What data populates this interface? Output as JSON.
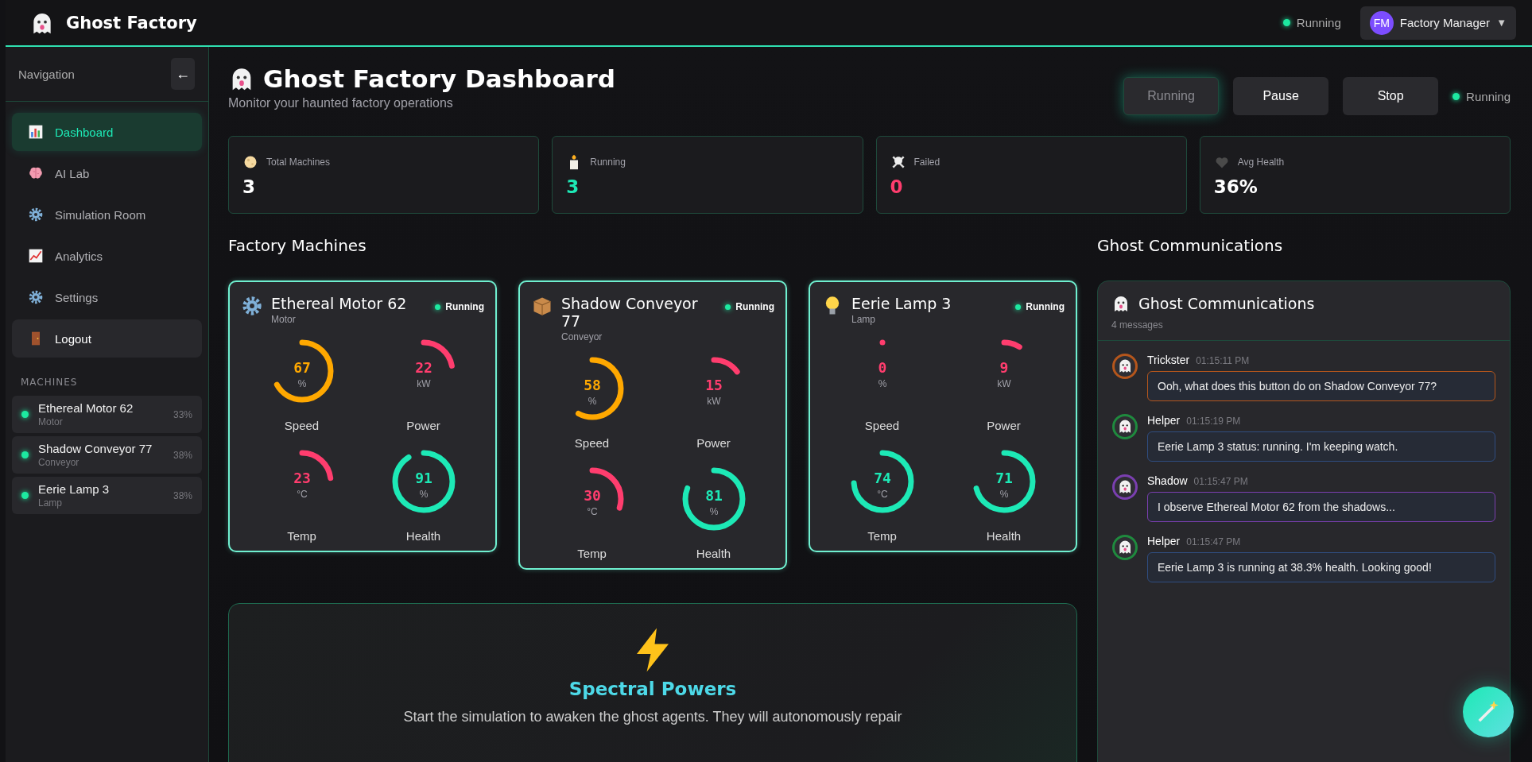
{
  "topbar": {
    "brand": "Ghost Factory",
    "status": "Running",
    "user": {
      "initials": "FM",
      "name": "Factory Manager",
      "caret": "▼"
    }
  },
  "sidebar": {
    "title": "Navigation",
    "collapse": "←",
    "items": [
      {
        "label": "Dashboard",
        "selected": true,
        "kind": "link"
      },
      {
        "label": "AI Lab",
        "selected": false,
        "kind": "link"
      },
      {
        "label": "Simulation Room",
        "selected": false,
        "kind": "link"
      },
      {
        "label": "Analytics",
        "selected": false,
        "kind": "link"
      },
      {
        "label": "Settings",
        "selected": false,
        "kind": "link"
      },
      {
        "label": "Logout",
        "selected": false,
        "kind": "action"
      }
    ],
    "machines_heading": "MACHINES",
    "machines": [
      {
        "name": "Ethereal Motor 62",
        "type": "Motor",
        "health": "33%",
        "running": true
      },
      {
        "name": "Shadow Conveyor 77",
        "type": "Conveyor",
        "health": "38%",
        "running": true
      },
      {
        "name": "Eerie Lamp 3",
        "type": "Lamp",
        "health": "38%",
        "running": true
      }
    ]
  },
  "header": {
    "title": "Ghost Factory Dashboard",
    "subtitle": "Monitor your haunted factory operations",
    "controls": [
      {
        "label": "Running",
        "selected": true
      },
      {
        "label": "Pause",
        "selected": false
      },
      {
        "label": "Stop",
        "selected": false
      }
    ],
    "status": "Running"
  },
  "stats": [
    {
      "label": "Total Machines",
      "value": "3",
      "color": "#ffffff"
    },
    {
      "label": "Running",
      "value": "3",
      "color": "#1de9b6"
    },
    {
      "label": "Failed",
      "value": "0",
      "color": "#ff3d6e"
    },
    {
      "label": "Avg Health",
      "value": "36%",
      "color": "#ffffff"
    }
  ],
  "machines_title": "Factory Machines",
  "machines": [
    {
      "name": "Ethereal Motor 62",
      "type": "Motor",
      "status": "Running",
      "gauges": [
        {
          "label": "Speed",
          "value": "67",
          "unit": "%",
          "level": 0.67,
          "color": "#ffa800"
        },
        {
          "label": "Power",
          "value": "22",
          "unit": "kW",
          "level": 0.22,
          "color": "#ff3d6e"
        },
        {
          "label": "Temp",
          "value": "23",
          "unit": "°C",
          "level": 0.23,
          "color": "#ff3d6e"
        },
        {
          "label": "Health",
          "value": "91",
          "unit": "%",
          "level": 0.91,
          "color": "#1de9b6"
        }
      ]
    },
    {
      "name": "Shadow Conveyor 77",
      "type": "Conveyor",
      "status": "Running",
      "gauges": [
        {
          "label": "Speed",
          "value": "58",
          "unit": "%",
          "level": 0.58,
          "color": "#ffa800"
        },
        {
          "label": "Power",
          "value": "15",
          "unit": "kW",
          "level": 0.15,
          "color": "#ff3d6e"
        },
        {
          "label": "Temp",
          "value": "30",
          "unit": "°C",
          "level": 0.3,
          "color": "#ff3d6e"
        },
        {
          "label": "Health",
          "value": "81",
          "unit": "%",
          "level": 0.81,
          "color": "#1de9b6"
        }
      ]
    },
    {
      "name": "Eerie Lamp 3",
      "type": "Lamp",
      "status": "Running",
      "gauges": [
        {
          "label": "Speed",
          "value": "0",
          "unit": "%",
          "level": 0,
          "color": "#ff3d6e"
        },
        {
          "label": "Power",
          "value": "9",
          "unit": "kW",
          "level": 0.09,
          "color": "#ff3d6e"
        },
        {
          "label": "Temp",
          "value": "74",
          "unit": "°C",
          "level": 0.74,
          "color": "#1de9b6"
        },
        {
          "label": "Health",
          "value": "71",
          "unit": "%",
          "level": 0.71,
          "color": "#1de9b6"
        }
      ]
    }
  ],
  "powers": {
    "title": "Spectral Powers",
    "text": "Start the simulation to awaken the ghost agents. They will autonomously repair"
  },
  "comms_title": "Ghost Communications",
  "comms": {
    "title": "Ghost Communications",
    "count": "4 messages",
    "messages": [
      {
        "author": "Trickster",
        "time": "01:15:11 PM",
        "text": "Ooh, what does this button do on Shadow Conveyor 77?",
        "color": "#b5561c"
      },
      {
        "author": "Helper",
        "time": "01:15:19 PM",
        "text": "Eerie Lamp 3 status: running. I'm keeping watch.",
        "color": "#1f8a3e"
      },
      {
        "author": "Shadow",
        "time": "01:15:47 PM",
        "text": "I observe Ethereal Motor 62 from the shadows...",
        "color": "#7a3fb0"
      },
      {
        "author": "Helper",
        "time": "01:15:47 PM",
        "text": "Eerie Lamp 3 is running at 38.3% health. Looking good!",
        "color": "#1f8a3e"
      }
    ]
  }
}
